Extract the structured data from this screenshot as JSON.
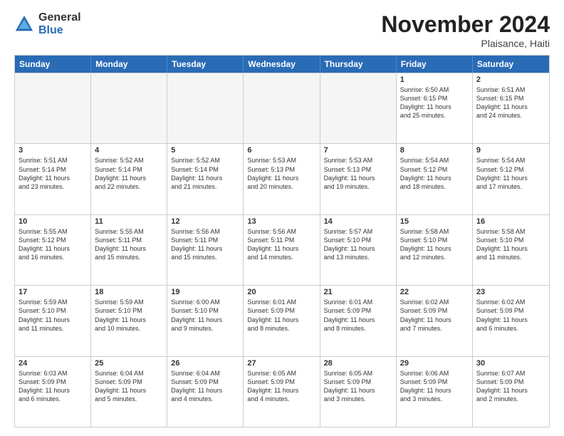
{
  "logo": {
    "general": "General",
    "blue": "Blue"
  },
  "title": "November 2024",
  "location": "Plaisance, Haiti",
  "days": [
    "Sunday",
    "Monday",
    "Tuesday",
    "Wednesday",
    "Thursday",
    "Friday",
    "Saturday"
  ],
  "rows": [
    [
      {
        "day": "",
        "empty": true
      },
      {
        "day": "",
        "empty": true
      },
      {
        "day": "",
        "empty": true
      },
      {
        "day": "",
        "empty": true
      },
      {
        "day": "",
        "empty": true
      },
      {
        "day": "1",
        "lines": [
          "Sunrise: 6:50 AM",
          "Sunset: 6:15 PM",
          "Daylight: 11 hours",
          "and 25 minutes."
        ]
      },
      {
        "day": "2",
        "lines": [
          "Sunrise: 6:51 AM",
          "Sunset: 6:15 PM",
          "Daylight: 11 hours",
          "and 24 minutes."
        ]
      }
    ],
    [
      {
        "day": "3",
        "lines": [
          "Sunrise: 5:51 AM",
          "Sunset: 5:14 PM",
          "Daylight: 11 hours",
          "and 23 minutes."
        ]
      },
      {
        "day": "4",
        "lines": [
          "Sunrise: 5:52 AM",
          "Sunset: 5:14 PM",
          "Daylight: 11 hours",
          "and 22 minutes."
        ]
      },
      {
        "day": "5",
        "lines": [
          "Sunrise: 5:52 AM",
          "Sunset: 5:14 PM",
          "Daylight: 11 hours",
          "and 21 minutes."
        ]
      },
      {
        "day": "6",
        "lines": [
          "Sunrise: 5:53 AM",
          "Sunset: 5:13 PM",
          "Daylight: 11 hours",
          "and 20 minutes."
        ]
      },
      {
        "day": "7",
        "lines": [
          "Sunrise: 5:53 AM",
          "Sunset: 5:13 PM",
          "Daylight: 11 hours",
          "and 19 minutes."
        ]
      },
      {
        "day": "8",
        "lines": [
          "Sunrise: 5:54 AM",
          "Sunset: 5:12 PM",
          "Daylight: 11 hours",
          "and 18 minutes."
        ]
      },
      {
        "day": "9",
        "lines": [
          "Sunrise: 5:54 AM",
          "Sunset: 5:12 PM",
          "Daylight: 11 hours",
          "and 17 minutes."
        ]
      }
    ],
    [
      {
        "day": "10",
        "lines": [
          "Sunrise: 5:55 AM",
          "Sunset: 5:12 PM",
          "Daylight: 11 hours",
          "and 16 minutes."
        ]
      },
      {
        "day": "11",
        "lines": [
          "Sunrise: 5:55 AM",
          "Sunset: 5:11 PM",
          "Daylight: 11 hours",
          "and 15 minutes."
        ]
      },
      {
        "day": "12",
        "lines": [
          "Sunrise: 5:56 AM",
          "Sunset: 5:11 PM",
          "Daylight: 11 hours",
          "and 15 minutes."
        ]
      },
      {
        "day": "13",
        "lines": [
          "Sunrise: 5:56 AM",
          "Sunset: 5:11 PM",
          "Daylight: 11 hours",
          "and 14 minutes."
        ]
      },
      {
        "day": "14",
        "lines": [
          "Sunrise: 5:57 AM",
          "Sunset: 5:10 PM",
          "Daylight: 11 hours",
          "and 13 minutes."
        ]
      },
      {
        "day": "15",
        "lines": [
          "Sunrise: 5:58 AM",
          "Sunset: 5:10 PM",
          "Daylight: 11 hours",
          "and 12 minutes."
        ]
      },
      {
        "day": "16",
        "lines": [
          "Sunrise: 5:58 AM",
          "Sunset: 5:10 PM",
          "Daylight: 11 hours",
          "and 11 minutes."
        ]
      }
    ],
    [
      {
        "day": "17",
        "lines": [
          "Sunrise: 5:59 AM",
          "Sunset: 5:10 PM",
          "Daylight: 11 hours",
          "and 11 minutes."
        ]
      },
      {
        "day": "18",
        "lines": [
          "Sunrise: 5:59 AM",
          "Sunset: 5:10 PM",
          "Daylight: 11 hours",
          "and 10 minutes."
        ]
      },
      {
        "day": "19",
        "lines": [
          "Sunrise: 6:00 AM",
          "Sunset: 5:10 PM",
          "Daylight: 11 hours",
          "and 9 minutes."
        ]
      },
      {
        "day": "20",
        "lines": [
          "Sunrise: 6:01 AM",
          "Sunset: 5:09 PM",
          "Daylight: 11 hours",
          "and 8 minutes."
        ]
      },
      {
        "day": "21",
        "lines": [
          "Sunrise: 6:01 AM",
          "Sunset: 5:09 PM",
          "Daylight: 11 hours",
          "and 8 minutes."
        ]
      },
      {
        "day": "22",
        "lines": [
          "Sunrise: 6:02 AM",
          "Sunset: 5:09 PM",
          "Daylight: 11 hours",
          "and 7 minutes."
        ]
      },
      {
        "day": "23",
        "lines": [
          "Sunrise: 6:02 AM",
          "Sunset: 5:09 PM",
          "Daylight: 11 hours",
          "and 6 minutes."
        ]
      }
    ],
    [
      {
        "day": "24",
        "lines": [
          "Sunrise: 6:03 AM",
          "Sunset: 5:09 PM",
          "Daylight: 11 hours",
          "and 6 minutes."
        ]
      },
      {
        "day": "25",
        "lines": [
          "Sunrise: 6:04 AM",
          "Sunset: 5:09 PM",
          "Daylight: 11 hours",
          "and 5 minutes."
        ]
      },
      {
        "day": "26",
        "lines": [
          "Sunrise: 6:04 AM",
          "Sunset: 5:09 PM",
          "Daylight: 11 hours",
          "and 4 minutes."
        ]
      },
      {
        "day": "27",
        "lines": [
          "Sunrise: 6:05 AM",
          "Sunset: 5:09 PM",
          "Daylight: 11 hours",
          "and 4 minutes."
        ]
      },
      {
        "day": "28",
        "lines": [
          "Sunrise: 6:05 AM",
          "Sunset: 5:09 PM",
          "Daylight: 11 hours",
          "and 3 minutes."
        ]
      },
      {
        "day": "29",
        "lines": [
          "Sunrise: 6:06 AM",
          "Sunset: 5:09 PM",
          "Daylight: 11 hours",
          "and 3 minutes."
        ]
      },
      {
        "day": "30",
        "lines": [
          "Sunrise: 6:07 AM",
          "Sunset: 5:09 PM",
          "Daylight: 11 hours",
          "and 2 minutes."
        ]
      }
    ]
  ]
}
